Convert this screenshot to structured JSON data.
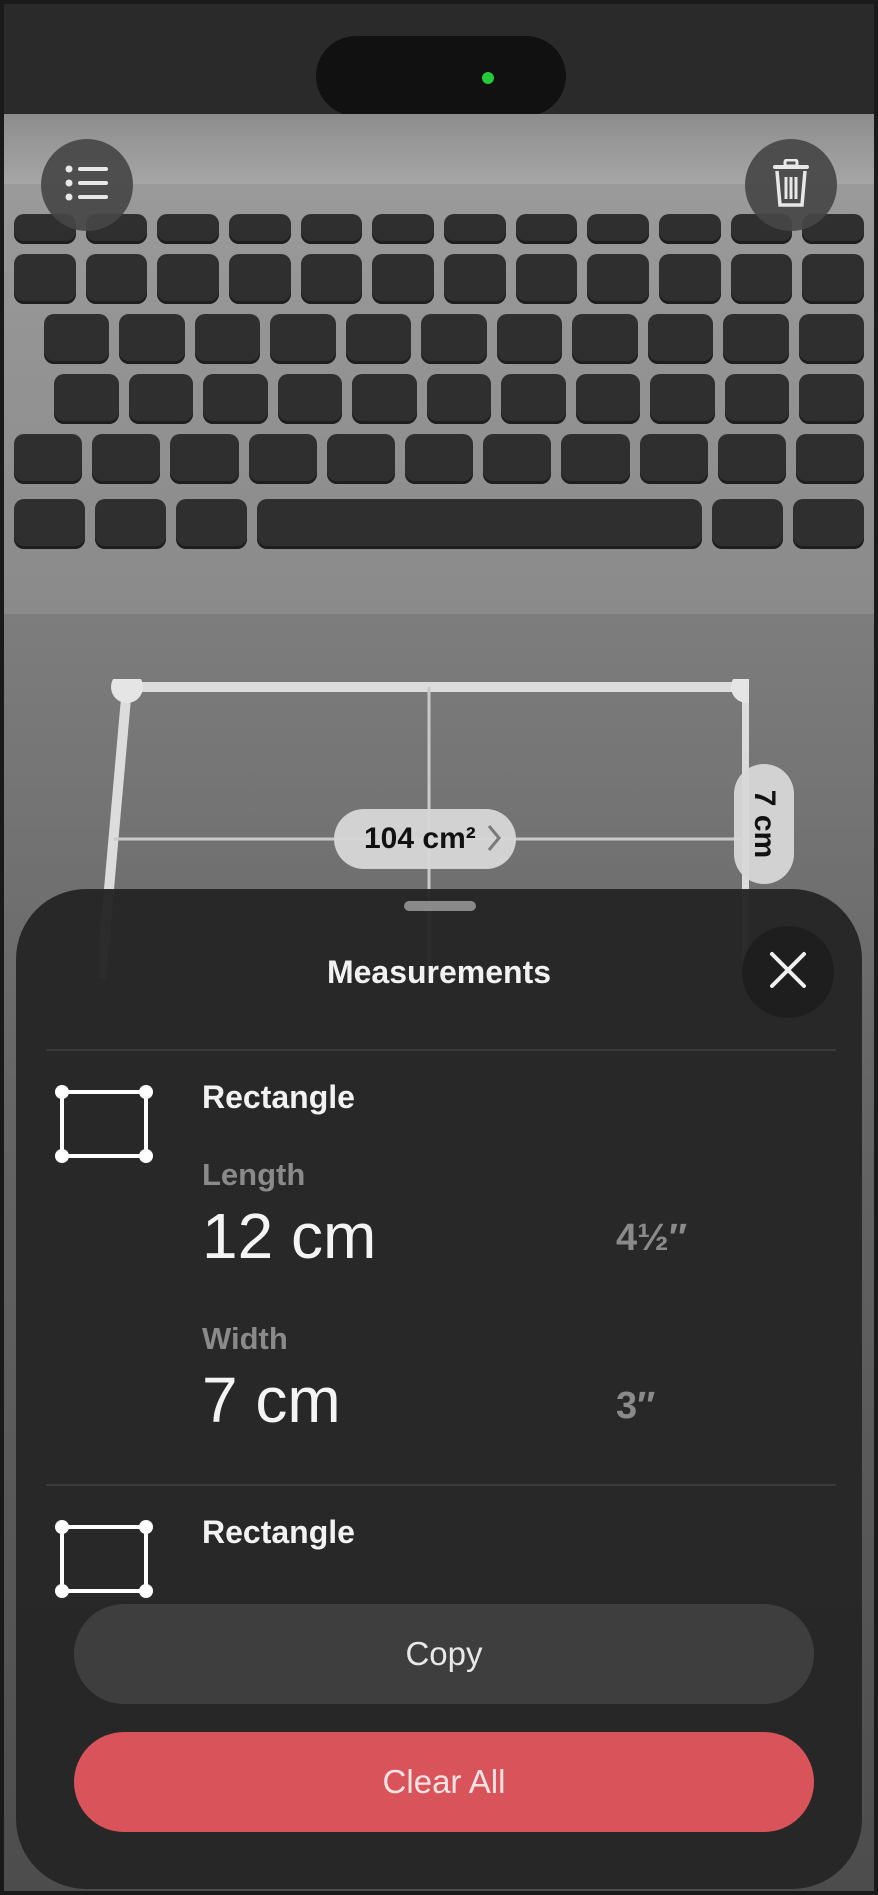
{
  "overlay": {
    "area_label": "104 cm²",
    "side_label": "7 cm"
  },
  "toolbar": {
    "list_icon": "list-icon",
    "trash_icon": "trash-icon"
  },
  "sheet": {
    "title": "Measurements",
    "close_icon": "close-icon",
    "items": [
      {
        "type_label": "Rectangle",
        "length_label": "Length",
        "length_value": "12 cm",
        "length_imperial": "4½″",
        "width_label": "Width",
        "width_value": "7 cm",
        "width_imperial": "3″"
      },
      {
        "type_label": "Rectangle"
      }
    ],
    "copy_label": "Copy",
    "clear_label": "Clear All"
  },
  "colors": {
    "accent_red": "#d9535a",
    "sheet_bg": "#262626",
    "camera_indicator": "#25c93a"
  }
}
